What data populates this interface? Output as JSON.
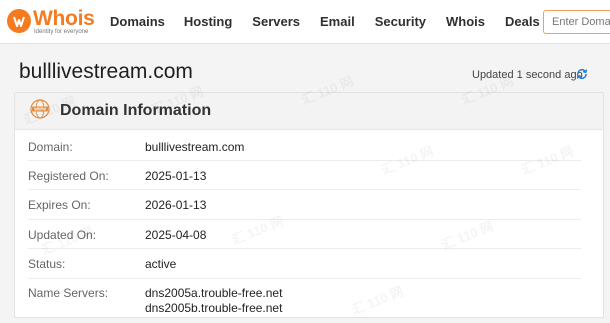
{
  "header": {
    "logo": {
      "name": "Whois",
      "tagline": "Identity for everyone"
    },
    "nav": [
      "Domains",
      "Hosting",
      "Servers",
      "Email",
      "Security",
      "Whois",
      "Deals"
    ],
    "search_placeholder": "Enter Domain"
  },
  "page": {
    "domain_title": "bulllivestream.com",
    "updated_text": "Updated 1 second ago"
  },
  "domain_info": {
    "title": "Domain Information",
    "rows": [
      {
        "label": "Domain:",
        "value": "bulllivestream.com"
      },
      {
        "label": "Registered On:",
        "value": "2025-01-13"
      },
      {
        "label": "Expires On:",
        "value": "2026-01-13"
      },
      {
        "label": "Updated On:",
        "value": "2025-04-08"
      },
      {
        "label": "Status:",
        "value": "active"
      },
      {
        "label": "Name Servers:",
        "values": [
          "dns2005a.trouble-free.net",
          "dns2005b.trouble-free.net"
        ]
      }
    ]
  },
  "watermark": "汇 110 网",
  "colors": {
    "brand": "#f47b20",
    "refresh_icon": "#2a7fd4"
  }
}
